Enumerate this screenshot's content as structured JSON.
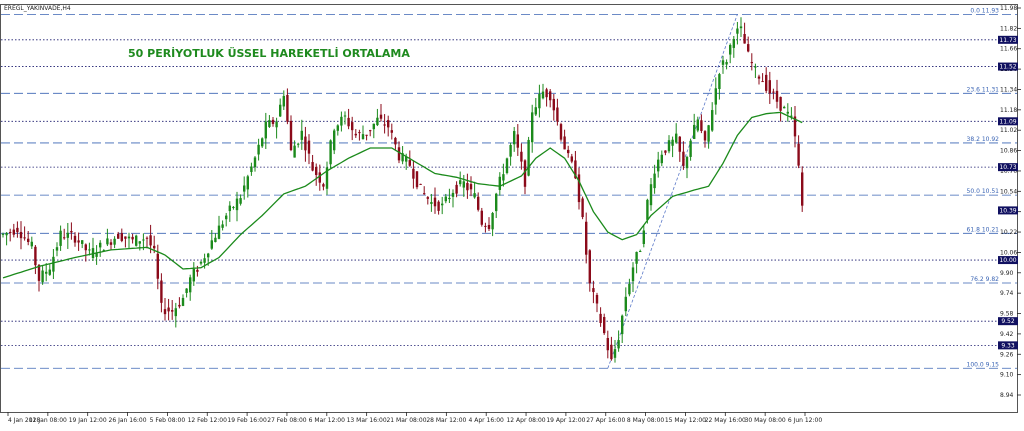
{
  "symbol_label": "EREGL_YAKINVADE,H4",
  "title": "50 PERİYOTLUK ÜSSEL HAREKETLİ ORTALAMA",
  "colors": {
    "bull": "#1c8a1c",
    "bear": "#8b0a1a",
    "ema": "#1b8a1b",
    "fib": "#3a64b4",
    "level": "#1a1a6e",
    "tag_bg": "#101060",
    "trend": "#5a78c8",
    "axis": "#222222"
  },
  "chart_data": {
    "type": "candlestick",
    "ylim": [
      8.94,
      11.98
    ],
    "y_ticks": [
      "11.98",
      "11.82",
      "11.66",
      "11.50",
      "11.34",
      "11.18",
      "11.02",
      "10.86",
      "10.70",
      "10.54",
      "10.38",
      "10.22",
      "10.06",
      "9.90",
      "9.74",
      "9.58",
      "9.42",
      "9.26",
      "9.10",
      "8.94"
    ],
    "x_ticks": [
      "4 Jan 2018",
      "12 Jan 08:00",
      "19 Jan 12:00",
      "26 Jan 16:00",
      "5 Feb 08:00",
      "12 Feb 12:00",
      "19 Feb 16:00",
      "27 Feb 08:00",
      "6 Mar 12:00",
      "13 Mar 16:00",
      "21 Mar 08:00",
      "28 Mar 12:00",
      "4 Apr 16:00",
      "12 Apr 08:00",
      "19 Apr 12:00",
      "27 Apr 16:00",
      "8 May 08:00",
      "15 May 12:00",
      "22 May 16:00",
      "30 May 08:00",
      "6 Jun 12:00"
    ],
    "last_price": 10.39,
    "level_lines": [
      {
        "value": 11.73,
        "label": "11.73"
      },
      {
        "value": 11.52,
        "label": "11.52"
      },
      {
        "value": 11.09,
        "label": "11.09"
      },
      {
        "value": 10.73,
        "label": "10.73"
      },
      {
        "value": 10.0,
        "label": "10.00"
      },
      {
        "value": 9.52,
        "label": "9.52"
      },
      {
        "value": 9.33,
        "label": "9.33"
      }
    ],
    "fib_levels": [
      {
        "value": 11.93,
        "label": "0.0  11.93"
      },
      {
        "value": 11.31,
        "label": "23.6  11.31"
      },
      {
        "value": 10.92,
        "label": "38.2  10.92"
      },
      {
        "value": 10.51,
        "label": "50.0  10.51"
      },
      {
        "value": 10.21,
        "label": "61.8  10.21"
      },
      {
        "value": 9.82,
        "label": "76.2  9.82"
      },
      {
        "value": 9.15,
        "label": "100.0  9.15"
      }
    ],
    "trendline": {
      "from": {
        "x_index": 168,
        "y": 9.15
      },
      "to": {
        "x_index": 204,
        "y": 11.93
      }
    },
    "ema_period": 50,
    "price_keys": [
      [
        0,
        10.2
      ],
      [
        4,
        10.25
      ],
      [
        8,
        10.1
      ],
      [
        10,
        9.85
      ],
      [
        13,
        9.95
      ],
      [
        16,
        10.2
      ],
      [
        20,
        10.18
      ],
      [
        24,
        10.05
      ],
      [
        28,
        10.12
      ],
      [
        32,
        10.2
      ],
      [
        36,
        10.15
      ],
      [
        40,
        10.18
      ],
      [
        42,
        10.05
      ],
      [
        44,
        9.62
      ],
      [
        47,
        9.6
      ],
      [
        50,
        9.7
      ],
      [
        52,
        9.85
      ],
      [
        55,
        9.98
      ],
      [
        58,
        10.15
      ],
      [
        62,
        10.35
      ],
      [
        66,
        10.5
      ],
      [
        70,
        10.8
      ],
      [
        73,
        11.05
      ],
      [
        76,
        11.1
      ],
      [
        78,
        11.32
      ],
      [
        80,
        10.85
      ],
      [
        83,
        11.0
      ],
      [
        86,
        10.72
      ],
      [
        89,
        10.6
      ],
      [
        92,
        11.05
      ],
      [
        95,
        11.12
      ],
      [
        98,
        10.98
      ],
      [
        101,
        11.0
      ],
      [
        104,
        11.1
      ],
      [
        107,
        11.05
      ],
      [
        110,
        10.82
      ],
      [
        113,
        10.75
      ],
      [
        116,
        10.55
      ],
      [
        119,
        10.45
      ],
      [
        122,
        10.42
      ],
      [
        125,
        10.55
      ],
      [
        128,
        10.6
      ],
      [
        131,
        10.5
      ],
      [
        133,
        10.3
      ],
      [
        135,
        10.28
      ],
      [
        137,
        10.52
      ],
      [
        140,
        10.8
      ],
      [
        142,
        10.98
      ],
      [
        145,
        10.62
      ],
      [
        147,
        11.18
      ],
      [
        150,
        11.32
      ],
      [
        152,
        11.3
      ],
      [
        155,
        10.98
      ],
      [
        157,
        10.8
      ],
      [
        159,
        10.68
      ],
      [
        161,
        10.3
      ],
      [
        163,
        9.8
      ],
      [
        165,
        9.62
      ],
      [
        167,
        9.42
      ],
      [
        169,
        9.2
      ],
      [
        171,
        9.4
      ],
      [
        173,
        9.72
      ],
      [
        175,
        9.95
      ],
      [
        177,
        10.1
      ],
      [
        179,
        10.45
      ],
      [
        181,
        10.72
      ],
      [
        183,
        10.85
      ],
      [
        185,
        10.9
      ],
      [
        187,
        10.95
      ],
      [
        189,
        10.72
      ],
      [
        191,
        10.95
      ],
      [
        193,
        11.1
      ],
      [
        195,
        10.9
      ],
      [
        197,
        11.2
      ],
      [
        199,
        11.5
      ],
      [
        201,
        11.58
      ],
      [
        203,
        11.78
      ],
      [
        205,
        11.8
      ],
      [
        207,
        11.6
      ],
      [
        209,
        11.48
      ],
      [
        211,
        11.42
      ],
      [
        213,
        11.32
      ],
      [
        215,
        11.25
      ],
      [
        217,
        11.18
      ],
      [
        219,
        11.1
      ],
      [
        220,
        10.95
      ],
      [
        221,
        10.72
      ],
      [
        222,
        10.42
      ]
    ],
    "ema_keys": [
      [
        0,
        9.86
      ],
      [
        10,
        9.95
      ],
      [
        20,
        10.02
      ],
      [
        30,
        10.08
      ],
      [
        40,
        10.1
      ],
      [
        45,
        10.04
      ],
      [
        50,
        9.93
      ],
      [
        55,
        9.94
      ],
      [
        60,
        10.02
      ],
      [
        66,
        10.2
      ],
      [
        72,
        10.35
      ],
      [
        78,
        10.52
      ],
      [
        84,
        10.58
      ],
      [
        90,
        10.7
      ],
      [
        96,
        10.8
      ],
      [
        102,
        10.88
      ],
      [
        108,
        10.88
      ],
      [
        114,
        10.78
      ],
      [
        120,
        10.68
      ],
      [
        126,
        10.65
      ],
      [
        132,
        10.6
      ],
      [
        138,
        10.58
      ],
      [
        144,
        10.66
      ],
      [
        148,
        10.8
      ],
      [
        152,
        10.88
      ],
      [
        156,
        10.8
      ],
      [
        160,
        10.62
      ],
      [
        164,
        10.38
      ],
      [
        168,
        10.22
      ],
      [
        172,
        10.16
      ],
      [
        176,
        10.2
      ],
      [
        180,
        10.35
      ],
      [
        186,
        10.5
      ],
      [
        192,
        10.55
      ],
      [
        196,
        10.58
      ],
      [
        200,
        10.76
      ],
      [
        204,
        10.98
      ],
      [
        208,
        11.12
      ],
      [
        212,
        11.15
      ],
      [
        216,
        11.16
      ],
      [
        219,
        11.12
      ],
      [
        222,
        11.08
      ]
    ]
  }
}
